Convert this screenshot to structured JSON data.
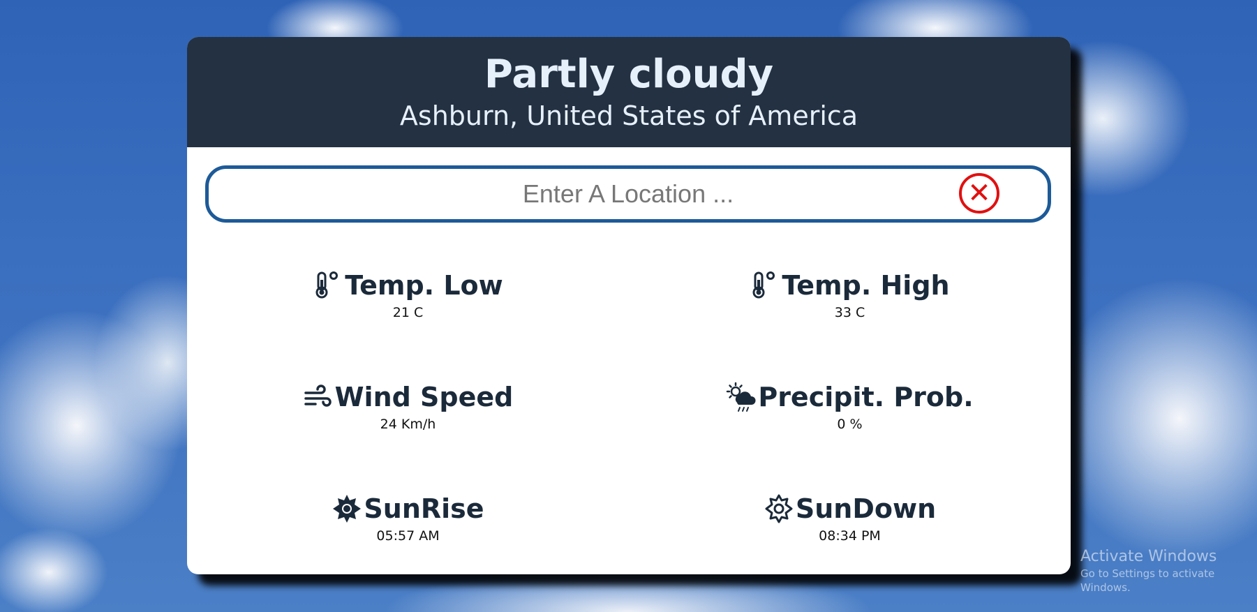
{
  "header": {
    "condition": "Partly cloudy",
    "location": "Ashburn, United States of America"
  },
  "search": {
    "placeholder": "Enter A Location ...",
    "value": "",
    "clear_icon": "close-circle-icon"
  },
  "stats": [
    {
      "label": "Temp. Low",
      "value": "21 C",
      "icon": "thermometer-icon"
    },
    {
      "label": "Temp. High",
      "value": "33 C",
      "icon": "thermometer-icon"
    },
    {
      "label": "Wind Speed",
      "value": "24 Km/h",
      "icon": "wind-icon"
    },
    {
      "label": "Precipit. Prob.",
      "value": "0 %",
      "icon": "sun-cloud-rain-icon"
    },
    {
      "label": "SunRise",
      "value": "05:57 AM",
      "icon": "sun-filled-icon"
    },
    {
      "label": "SunDown",
      "value": "08:34 PM",
      "icon": "sun-outline-icon"
    }
  ],
  "watermark": {
    "line1": "Activate Windows",
    "line2": "Go to Settings to activate Windows."
  },
  "colors": {
    "header_bg": "#233142",
    "header_text": "#e6f0fb",
    "search_border": "#1d5a98",
    "clear_red": "#e01010",
    "label_text": "#1b2a3a"
  }
}
